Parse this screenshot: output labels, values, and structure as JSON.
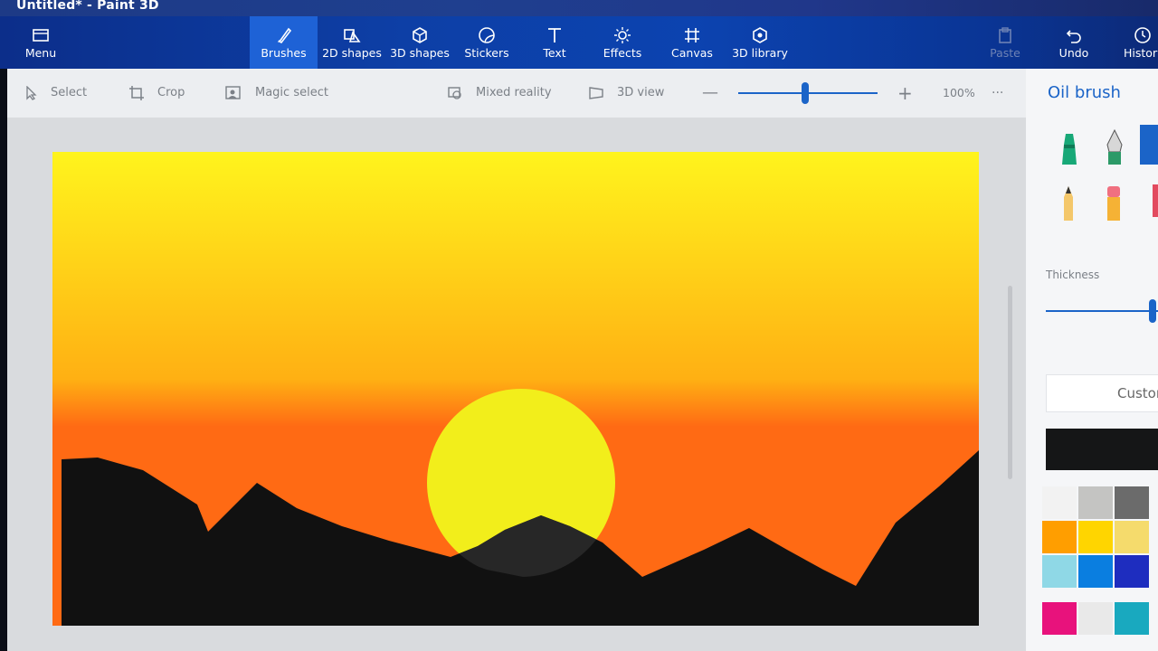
{
  "window": {
    "title": "Untitled* - Paint 3D"
  },
  "ribbon": {
    "menu": "Menu",
    "brushes": "Brushes",
    "shapes2d": "2D shapes",
    "shapes3d": "3D shapes",
    "stickers": "Stickers",
    "text": "Text",
    "effects": "Effects",
    "canvas": "Canvas",
    "library3d": "3D library",
    "paste": "Paste",
    "undo": "Undo",
    "history": "History"
  },
  "toolbar": {
    "select": "Select",
    "crop": "Crop",
    "magic_select": "Magic select",
    "mixed_reality": "Mixed reality",
    "view3d": "3D view",
    "zoom": "100%",
    "zoom_level": 0.48,
    "more": "···"
  },
  "panel": {
    "title": "Oil brush",
    "thickness_label": "Thickness",
    "thickness_value": 0.95,
    "custom_label": "Custom",
    "current_color": "#151617",
    "palette": [
      "#f2f2f2",
      "#c4c4c2",
      "#6b6b6b",
      "#ff9e00",
      "#ffd500",
      "#f5db6c",
      "#8fd8e6",
      "#0a7ee0",
      "#1e2dbf",
      "#e8127c",
      "#e9e9e9",
      "#19a9bf"
    ]
  },
  "art": {
    "sky_top": "#fff41d",
    "sky_mid": "#ffb013",
    "sky_low": "#ff6a14",
    "sun_color": "#f2ee1b",
    "mountain_color": "#111111"
  }
}
